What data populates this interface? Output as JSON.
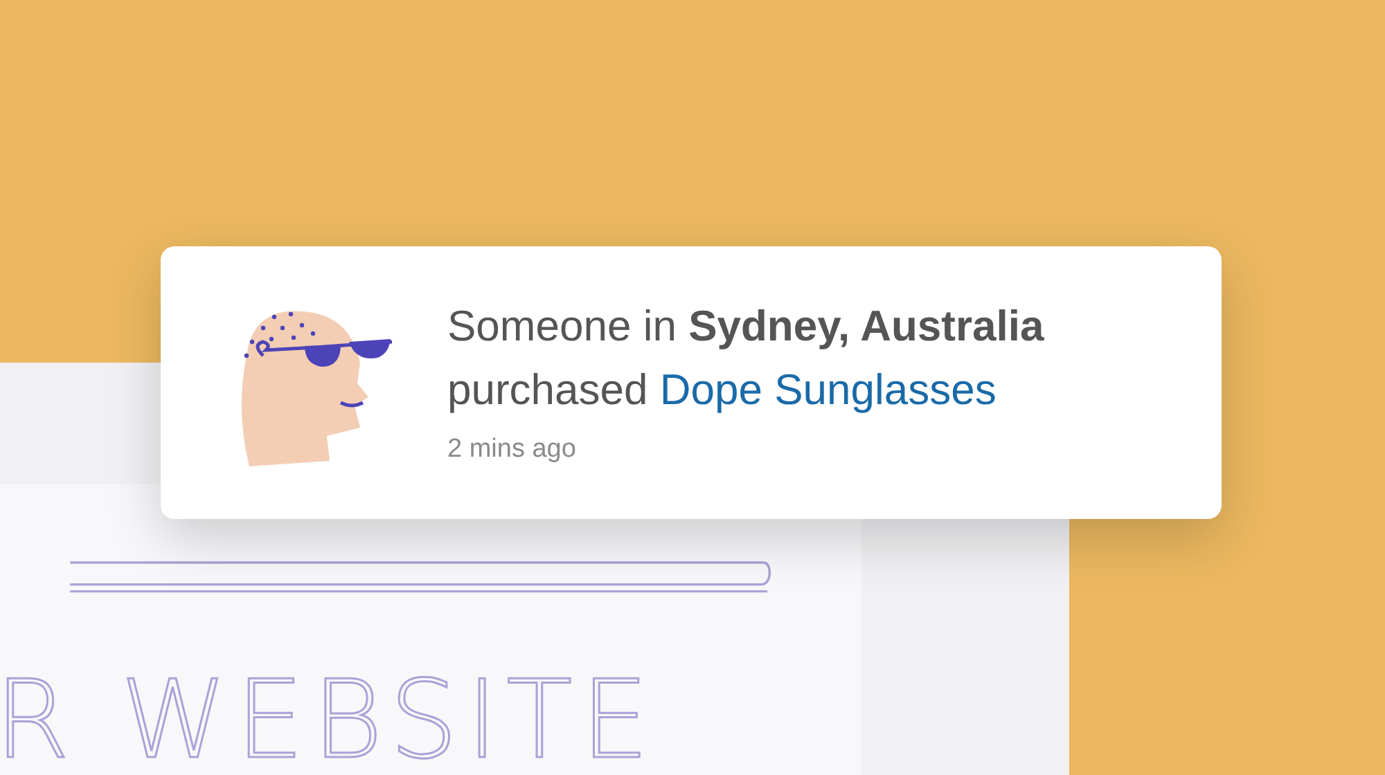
{
  "notification": {
    "message": "Someone in **Sydney, Australia** purchased",
    "product": "Dope Sunglasses",
    "time": "2 mins ago"
  },
  "website": {
    "heading": "R WEBSITE"
  }
}
